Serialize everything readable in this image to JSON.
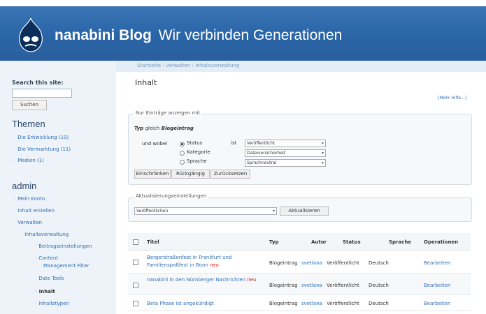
{
  "header": {
    "site_name": "nanabini Blog",
    "slogan": "Wir verbinden Generationen",
    "breadcrumb": "Startseite › Verwalten › Inhaltsverwaltung"
  },
  "sidebar": {
    "search": {
      "label": "Search this site:",
      "value": "",
      "button": "Suchen"
    },
    "themen": {
      "title": "Themen",
      "items": [
        {
          "label": "Die Entwicklung (10)"
        },
        {
          "label": "Die Vermarktung (11)"
        },
        {
          "label": "Medien (1)"
        }
      ]
    },
    "admin": {
      "title": "admin",
      "items": [
        {
          "label": "Mein Konto"
        },
        {
          "label": "Inhalt erstellen"
        },
        {
          "label": "Verwalten"
        },
        {
          "label": "Inhaltsverwaltung"
        },
        {
          "label": "Beitragseinstellungen"
        },
        {
          "label": "Content"
        },
        {
          "label": "Management Filter"
        },
        {
          "label": "Date Tools"
        },
        {
          "label": "Inhalt"
        },
        {
          "label": "Inhaltstypen"
        }
      ]
    }
  },
  "main": {
    "title": "Inhalt",
    "help_link": "[Mehr Hilfe...]",
    "filter": {
      "legend": "Nur Einträge anzeigen mit",
      "type_label": "Typ",
      "type_mid": "gleich",
      "type_value": "Blogeintrag",
      "and_where": "und wobei",
      "is_label": "ist",
      "radios": [
        {
          "label": "Status",
          "selected": true
        },
        {
          "label": "Kategorie",
          "selected": false
        },
        {
          "label": "Sprache",
          "selected": false
        }
      ],
      "selects": [
        "Veröffentlicht",
        "Dateiversicherheit",
        "Sprachneutral"
      ],
      "buttons": [
        "Einschränken",
        "Rückgängig",
        "Zurücksetzen"
      ]
    },
    "update": {
      "legend": "Aktualisierungseinstellungen",
      "select_value": "Veröffentlichen",
      "button": "Aktualisieren"
    },
    "table": {
      "headers": [
        "Titel",
        "Typ",
        "Autor",
        "Status",
        "Sprache",
        "Operationen"
      ],
      "rows": [
        {
          "title": "Bergerstraßenfest in Frankfurt und Familienspaßfest in Bonn",
          "new": "neu",
          "type": "Blogeintrag",
          "author": "svetlana",
          "status": "Veröffentlicht",
          "language": "Deutsch",
          "operation": "Bearbeiten"
        },
        {
          "title": "nanabini in den Nürnberger Nachrichten",
          "new": "neu",
          "type": "Blogeintrag",
          "author": "svetlana",
          "status": "Veröffentlicht",
          "language": "Deutsch",
          "operation": "Bearbeiten"
        },
        {
          "title": "Beta Phase ist angekündigt",
          "new": "",
          "type": "Blogeintrag",
          "author": "svetlana",
          "status": "Veröffentlicht",
          "language": "Deutsch",
          "operation": "Bearbeiten"
        }
      ]
    }
  },
  "colors": {
    "header": "#2a66a8",
    "sidebar": "#edf3f9",
    "link": "#2f6fb5",
    "new": "#dd2222"
  }
}
